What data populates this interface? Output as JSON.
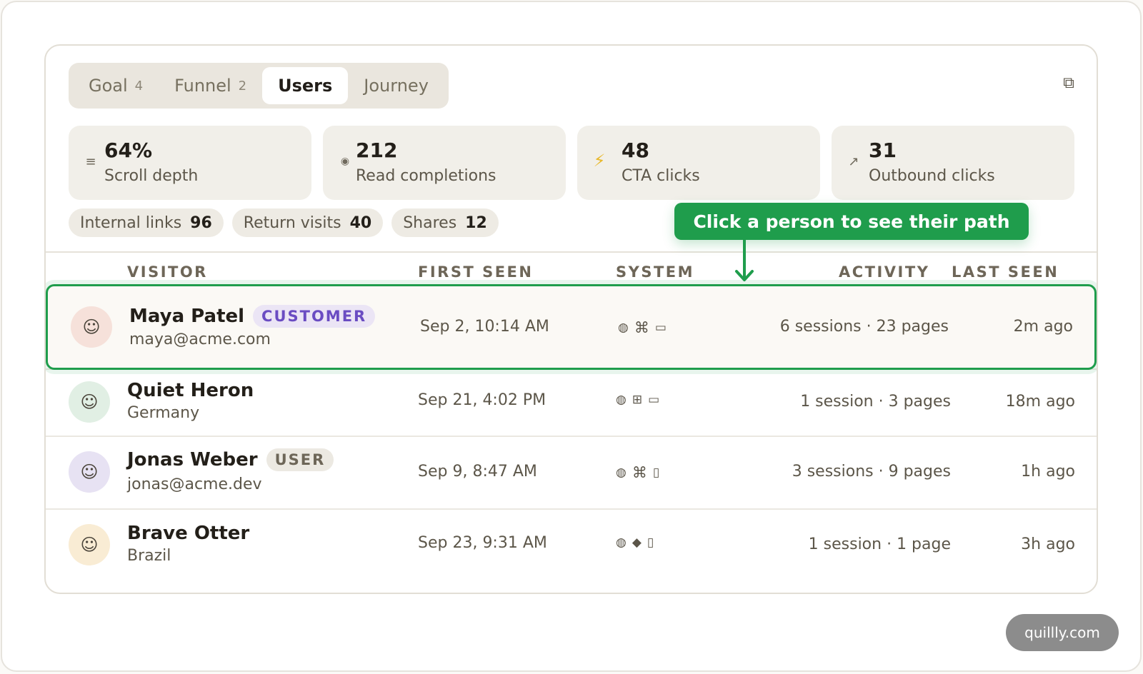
{
  "tabs": [
    {
      "label": "Goal",
      "count": "4"
    },
    {
      "label": "Funnel",
      "count": "2"
    },
    {
      "label": "Users",
      "count": ""
    },
    {
      "label": "Journey",
      "count": ""
    }
  ],
  "active_tab": "Users",
  "stats": [
    {
      "icon": "list-icon",
      "value": "64%",
      "label": "Scroll depth"
    },
    {
      "icon": "target-icon",
      "value": "212",
      "label": "Read completions"
    },
    {
      "icon": "bolt-icon",
      "value": "48",
      "label": "CTA clicks"
    },
    {
      "icon": "arrow-out-icon",
      "value": "31",
      "label": "Outbound clicks"
    }
  ],
  "chips": [
    {
      "label": "Internal links",
      "value": "96"
    },
    {
      "label": "Return visits",
      "value": "40"
    },
    {
      "label": "Shares",
      "value": "12"
    }
  ],
  "callout": "Click a person to see their path",
  "columns": {
    "visitor": "VISITOR",
    "first_seen": "FIRST SEEN",
    "system": "SYSTEM",
    "activity": "ACTIVITY",
    "last_seen": "LAST SEEN"
  },
  "rows": [
    {
      "name": "Maya Patel",
      "badge": "CUSTOMER",
      "sub": "maya@acme.com",
      "first_seen": "Sep 2, 10:14 AM",
      "system": [
        "◍",
        "⌘",
        "▭"
      ],
      "activity": "6 sessions · 23 pages",
      "last_seen": "2m ago",
      "avatar_color": "#f6e1da"
    },
    {
      "name": "Quiet Heron",
      "badge": "",
      "sub": "Germany",
      "first_seen": "Sep 21, 4:02 PM",
      "system": [
        "◍",
        "⊞",
        "▭"
      ],
      "activity": "1 session · 3 pages",
      "last_seen": "18m ago",
      "avatar_color": "#e1efe4"
    },
    {
      "name": "Jonas Weber",
      "badge": "USER",
      "sub": "jonas@acme.dev",
      "first_seen": "Sep 9, 8:47 AM",
      "system": [
        "◍",
        "⌘",
        "▯"
      ],
      "activity": "3 sessions · 9 pages",
      "last_seen": "1h ago",
      "avatar_color": "#e7e2f3"
    },
    {
      "name": "Brave Otter",
      "badge": "",
      "sub": "Brazil",
      "first_seen": "Sep 23, 9:31 AM",
      "system": [
        "◍",
        "◆",
        "▯"
      ],
      "activity": "1 session · 1 page",
      "last_seen": "3h ago",
      "avatar_color": "#f9ecd4"
    }
  ],
  "colors": {
    "accent": "#1f9d4c",
    "customer_badge": "#6a4cc2"
  },
  "watermark": "quillly.com"
}
